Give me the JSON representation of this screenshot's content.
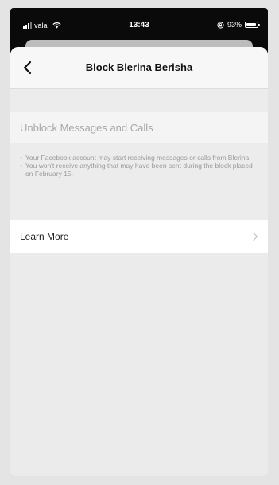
{
  "status_bar": {
    "carrier": "vala",
    "time": "13:43",
    "battery": "93%",
    "battery_level": 0.93,
    "icons": [
      "signal-icon",
      "wifi-icon",
      "orientation-lock-icon",
      "battery-icon"
    ]
  },
  "header": {
    "title": "Block Blerina Berisha",
    "back_icon": "chevron-left-icon"
  },
  "unblock": {
    "label": "Unblock Messages and Calls"
  },
  "notes": [
    "Your Facebook account may start receiving messages or calls from Blerina.",
    "You won't receive anything that may have been sent during the block placed on February 15."
  ],
  "learn_more": {
    "label": "Learn More",
    "icon": "chevron-right-icon"
  },
  "colors": {
    "sheet_background": "#ececec",
    "row_background": "#ffffff",
    "muted_text": "#a7a7a7",
    "primary_text": "#111111"
  }
}
